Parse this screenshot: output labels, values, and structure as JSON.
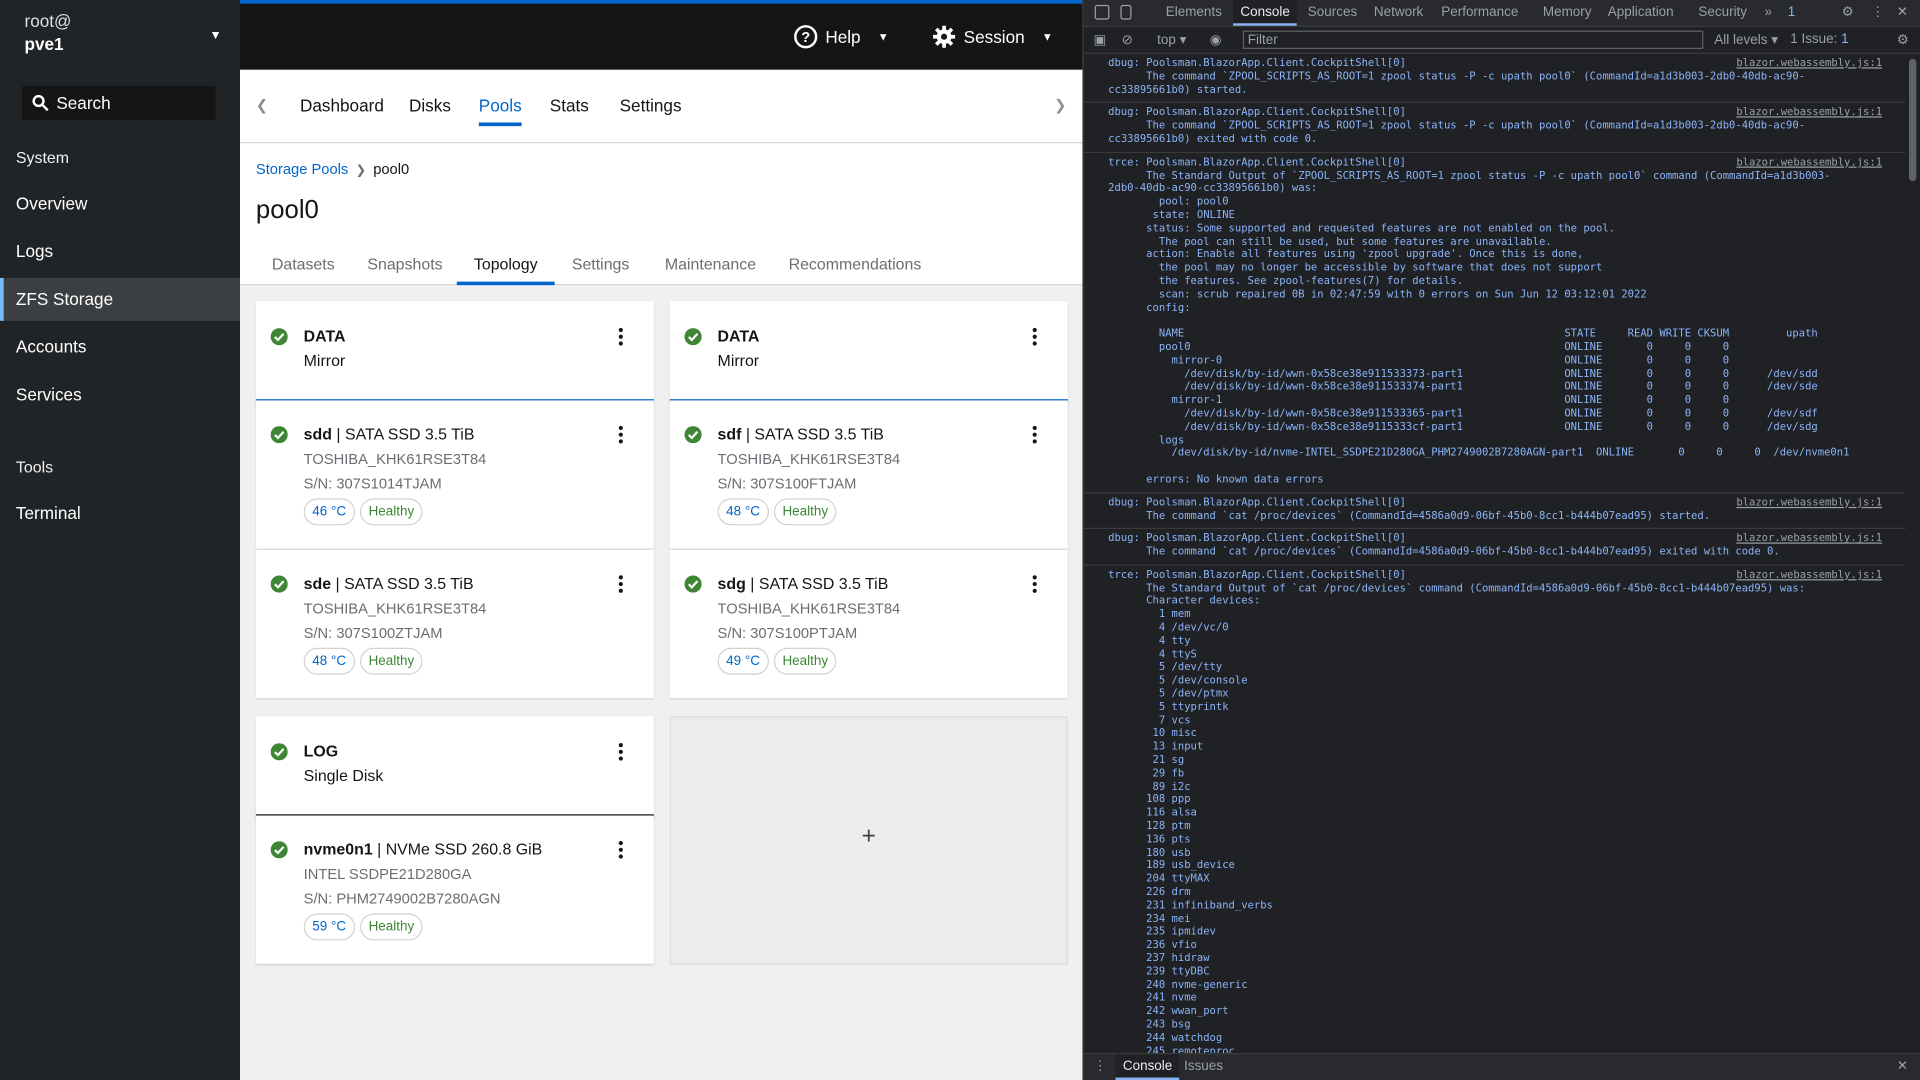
{
  "nav": {
    "user_line1": "root@",
    "user_line2": "pve1",
    "search_label": "Search",
    "section_system": "System",
    "items": [
      "Overview",
      "Logs",
      "ZFS Storage",
      "Accounts",
      "Services"
    ],
    "section_tools": "Tools",
    "tools_items": [
      "Terminal"
    ]
  },
  "header": {
    "help": "Help",
    "session": "Session"
  },
  "tabs": [
    "Dashboard",
    "Disks",
    "Pools",
    "Stats",
    "Settings"
  ],
  "breadcrumb": {
    "parent": "Storage Pools",
    "current": "pool0"
  },
  "page_title": "pool0",
  "subtabs": [
    "Datasets",
    "Snapshots",
    "Topology",
    "Settings",
    "Maintenance",
    "Recommendations"
  ],
  "vdevs": [
    {
      "type": "DATA",
      "layout": "Mirror"
    },
    {
      "type": "DATA",
      "layout": "Mirror"
    },
    {
      "type": "LOG",
      "layout": "Single Disk"
    }
  ],
  "disks": [
    {
      "name": "sdd",
      "desc": " | SATA SSD 3.5 TiB",
      "model": "TOSHIBA_KHK61RSE3T84",
      "serial": "S/N: 307S1014TJAM",
      "temp": "46 °C",
      "health": "Healthy"
    },
    {
      "name": "sdf",
      "desc": " | SATA SSD 3.5 TiB",
      "model": "TOSHIBA_KHK61RSE3T84",
      "serial": "S/N: 307S100FTJAM",
      "temp": "48 °C",
      "health": "Healthy"
    },
    {
      "name": "sde",
      "desc": " | SATA SSD 3.5 TiB",
      "model": "TOSHIBA_KHK61RSE3T84",
      "serial": "S/N: 307S100ZTJAM",
      "temp": "48 °C",
      "health": "Healthy"
    },
    {
      "name": "sdg",
      "desc": " | SATA SSD 3.5 TiB",
      "model": "TOSHIBA_KHK61RSE3T84",
      "serial": "S/N: 307S100PTJAM",
      "temp": "49 °C",
      "health": "Healthy"
    },
    {
      "name": "nvme0n1",
      "desc": " | NVMe SSD 260.8 GiB",
      "model": "INTEL SSDPE21D280GA",
      "serial": "S/N: PHM2749002B7280AGN",
      "temp": "59 °C",
      "health": "Healthy"
    }
  ],
  "add_symbol": "+",
  "devtools": {
    "tabs": [
      "Elements",
      "Console",
      "Sources",
      "Network",
      "Performance",
      "Memory",
      "Application",
      "Security"
    ],
    "more": "»",
    "issues_badge": "1",
    "context": "top ▾",
    "filter_placeholder": "Filter",
    "levels": "All levels ▾",
    "issues_btn": "1 Issue: ",
    "issues_count": "1",
    "close": "✕",
    "source": "blazor.webassembly.js:1",
    "messages": [
      "dbug: Poolsman.BlazorApp.Client.CockpitShell[0]\n      The command `ZPOOL_SCRIPTS_AS_ROOT=1 zpool status -P -c upath pool0` (CommandId=a1d3b003-2db0-40db-ac90-\ncc33895661b0) started.",
      "dbug: Poolsman.BlazorApp.Client.CockpitShell[0]\n      The command `ZPOOL_SCRIPTS_AS_ROOT=1 zpool status -P -c upath pool0` (CommandId=a1d3b003-2db0-40db-ac90-\ncc33895661b0) exited with code 0.",
      "trce: Poolsman.BlazorApp.Client.CockpitShell[0]\n      The Standard Output of `ZPOOL_SCRIPTS_AS_ROOT=1 zpool status -P -c upath pool0` command (CommandId=a1d3b003-\n2db0-40db-ac90-cc33895661b0) was:\n        pool: pool0\n       state: ONLINE\n      status: Some supported and requested features are not enabled on the pool.\n        The pool can still be used, but some features are unavailable.\n      action: Enable all features using 'zpool upgrade'. Once this is done,\n        the pool may no longer be accessible by software that does not support\n        the features. See zpool-features(7) for details.\n        scan: scrub repaired 0B in 02:47:59 with 0 errors on Sun Jun 12 03:12:01 2022\n      config:\n\n        NAME                                                            STATE     READ WRITE CKSUM         upath\n        pool0                                                           ONLINE       0     0     0\n          mirror-0                                                      ONLINE       0     0     0\n            /dev/disk/by-id/wwn-0x58ce38e911533373-part1                ONLINE       0     0     0      /dev/sdd\n            /dev/disk/by-id/wwn-0x58ce38e911533374-part1                ONLINE       0     0     0      /dev/sde\n          mirror-1                                                      ONLINE       0     0     0\n            /dev/disk/by-id/wwn-0x58ce38e911533365-part1                ONLINE       0     0     0      /dev/sdf\n            /dev/disk/by-id/wwn-0x58ce38e9115333cf-part1                ONLINE       0     0     0      /dev/sdg\n        logs\n          /dev/disk/by-id/nvme-INTEL_SSDPE21D280GA_PHM2749002B7280AGN-part1  ONLINE       0     0     0  /dev/nvme0n1\n\n      errors: No known data errors",
      "dbug: Poolsman.BlazorApp.Client.CockpitShell[0]\n      The command `cat /proc/devices` (CommandId=4586a0d9-06bf-45b0-8cc1-b444b07ead95) started.",
      "dbug: Poolsman.BlazorApp.Client.CockpitShell[0]\n      The command `cat /proc/devices` (CommandId=4586a0d9-06bf-45b0-8cc1-b444b07ead95) exited with code 0.",
      "trce: Poolsman.BlazorApp.Client.CockpitShell[0]\n      The Standard Output of `cat /proc/devices` command (CommandId=4586a0d9-06bf-45b0-8cc1-b444b07ead95) was:\n      Character devices:\n        1 mem\n        4 /dev/vc/0\n        4 tty\n        4 ttyS\n        5 /dev/tty\n        5 /dev/console\n        5 /dev/ptmx\n        5 ttyprintk\n        7 vcs\n       10 misc\n       13 input\n       21 sg\n       29 fb\n       89 i2c\n      108 ppp\n      116 alsa\n      128 ptm\n      136 pts\n      180 usb\n      189 usb_device\n      204 ttyMAX\n      226 drm\n      231 infiniband_verbs\n      234 mei\n      235 ipmidev\n      236 vfio\n      237 hidraw\n      239 ttyDBC\n      240 nvme-generic\n      241 nvme\n      242 wwan_port\n      243 bsg\n      244 watchdog\n      245 remoteproc"
    ],
    "drawer_tabs": [
      "Console",
      "Issues"
    ]
  }
}
